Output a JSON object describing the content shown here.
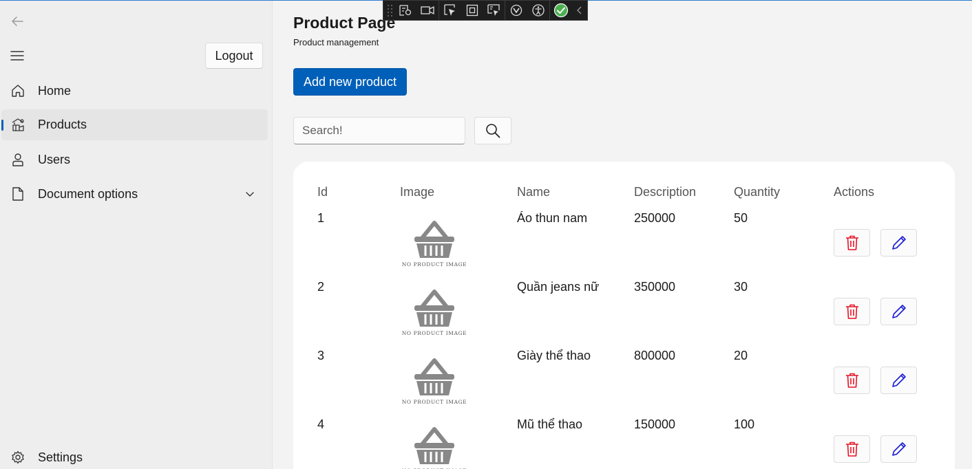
{
  "sidebar": {
    "logout_label": "Logout",
    "items": [
      {
        "label": "Home",
        "icon": "home-icon"
      },
      {
        "label": "Products",
        "icon": "products-icon",
        "selected": true
      },
      {
        "label": "Users",
        "icon": "user-icon"
      },
      {
        "label": "Document options",
        "icon": "document-icon",
        "expandable": true
      }
    ],
    "footer_item": {
      "label": "Settings",
      "icon": "gear-icon"
    }
  },
  "main": {
    "title": "Product Page",
    "subtitle": "Product management",
    "add_button_label": "Add new product",
    "search": {
      "placeholder": "Search!",
      "value": ""
    },
    "table": {
      "headers": [
        "Id",
        "Image",
        "Name",
        "Description",
        "Quantity",
        "Actions"
      ],
      "rows": [
        {
          "id": "1",
          "name": "Áo thun nam",
          "description": "250000",
          "quantity": "50"
        },
        {
          "id": "2",
          "name": "Quần jeans nữ",
          "description": "350000",
          "quantity": "30"
        },
        {
          "id": "3",
          "name": "Giày thể thao",
          "description": "800000",
          "quantity": "20"
        },
        {
          "id": "4",
          "name": "Mũ thể thao",
          "description": "150000",
          "quantity": "100"
        }
      ],
      "image_placeholder_text": "NO PRODUCT IMAGE"
    }
  },
  "colors": {
    "accent": "#005fb8",
    "delete": "#e81123",
    "edit": "#1a1ad6",
    "placeholder_image": "#888888"
  }
}
